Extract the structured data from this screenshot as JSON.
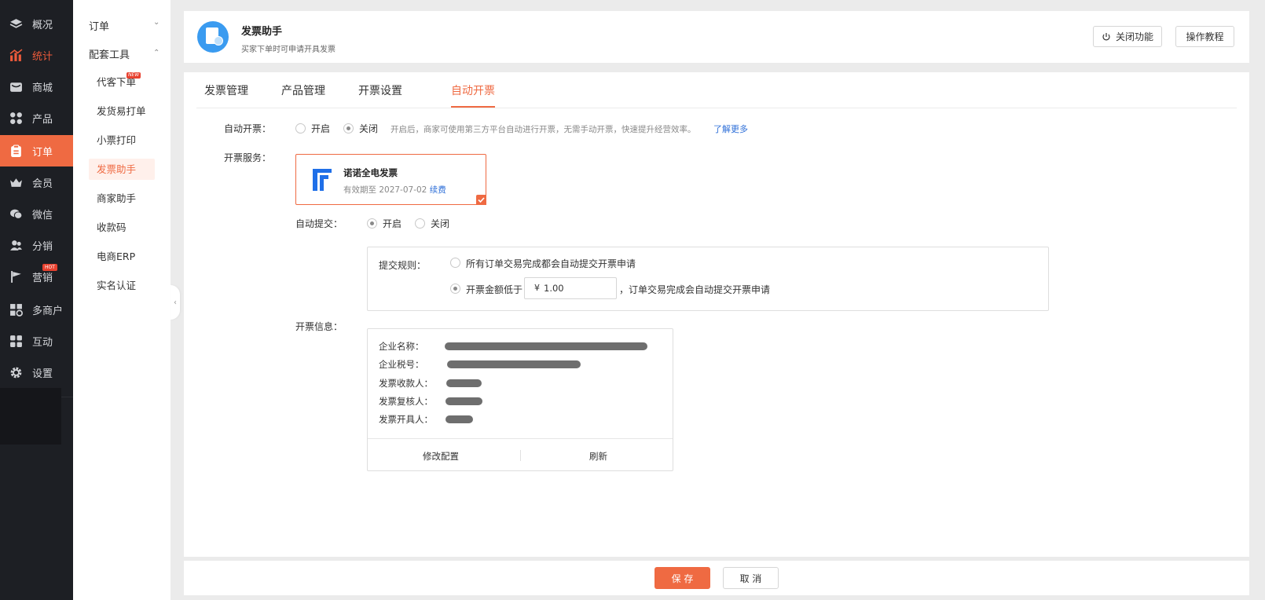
{
  "nav1": {
    "items": [
      {
        "label": "概况",
        "icon": "layers-icon"
      },
      {
        "label": "统计",
        "icon": "chart-icon"
      },
      {
        "label": "商城",
        "icon": "store-icon"
      },
      {
        "label": "产品",
        "icon": "grid-icon"
      },
      {
        "label": "订单",
        "icon": "clipboard-icon"
      },
      {
        "label": "会员",
        "icon": "crown-icon"
      },
      {
        "label": "微信",
        "icon": "wechat-icon"
      },
      {
        "label": "分销",
        "icon": "users-icon"
      },
      {
        "label": "营销",
        "icon": "flag-icon",
        "badge": "HOT"
      },
      {
        "label": "多商户",
        "icon": "shop-icon"
      },
      {
        "label": "互动",
        "icon": "apps-icon"
      },
      {
        "label": "设置",
        "icon": "gear-icon"
      }
    ],
    "accent": "#ef6a42",
    "bg": "#1d1f24"
  },
  "nav2": {
    "group_order": "订单",
    "group_tools": "配套工具",
    "items": [
      "代客下单",
      "发货易打单",
      "小票打印",
      "发票助手",
      "商家助手",
      "收款码",
      "电商ERP",
      "实名认证"
    ],
    "new_badge": "NEW"
  },
  "header": {
    "title": "发票助手",
    "subtitle": "买家下单时可申请开具发票",
    "btn_close": "关闭功能",
    "btn_tutorial": "操作教程"
  },
  "tabs": [
    "发票管理",
    "产品管理",
    "开票设置",
    "自动开票"
  ],
  "form": {
    "auto_invoice_label": "自动开票：",
    "on": "开启",
    "off": "关闭",
    "auto_invoice_hint": "开启后，商家可使用第三方平台自动进行开票，无需手动开票，快速提升经营效率。",
    "learn_more": "了解更多",
    "service_label": "开票服务：",
    "service_name": "诺诺全电发票",
    "service_expiry": "有效期至 2027-07-02",
    "service_renew": "续费",
    "auto_submit_label": "自动提交：",
    "rule_label": "提交规则：",
    "rule_all": "所有订单交易完成都会自动提交开票申请",
    "rule_amount_prefix": "开票金额低于",
    "rule_amount_currency": "¥",
    "rule_amount_value": "1.00",
    "rule_amount_suffix": "，订单交易完成会自动提交开票申请",
    "info_label": "开票信息：",
    "info_fields": [
      "企业名称：",
      "企业税号：",
      "发票收款人：",
      "发票复核人：",
      "发票开具人："
    ],
    "info_edit": "修改配置",
    "info_refresh": "刷新"
  },
  "footer": {
    "save": "保 存",
    "cancel": "取 消"
  }
}
